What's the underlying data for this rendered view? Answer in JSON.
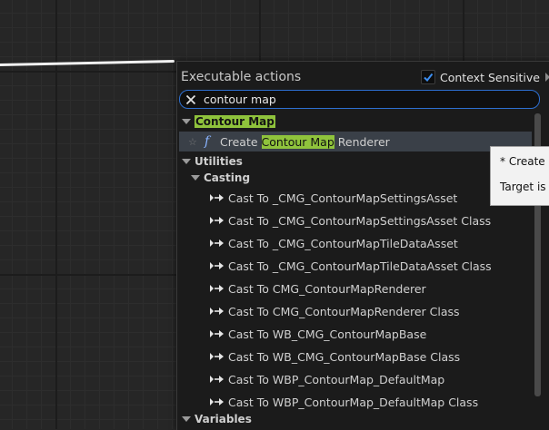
{
  "menu": {
    "title": "Executable actions",
    "context_sensitive": {
      "label": "Context Sensitive",
      "checked": true
    }
  },
  "search": {
    "value": "contour map"
  },
  "results": {
    "contour_category": {
      "label": "Contour Map"
    },
    "create_item": {
      "prefix": "Create ",
      "match": "Contour Map",
      "suffix": " Renderer"
    },
    "utilities": {
      "label": "Utilities"
    },
    "casting": {
      "label": "Casting"
    },
    "cast_items": [
      "Cast To _CMG_ContourMapSettingsAsset",
      "Cast To _CMG_ContourMapSettingsAsset Class",
      "Cast To _CMG_ContourMapTileDataAsset",
      "Cast To _CMG_ContourMapTileDataAsset Class",
      "Cast To CMG_ContourMapRenderer",
      "Cast To CMG_ContourMapRenderer Class",
      "Cast To WB_CMG_ContourMapBase",
      "Cast To WB_CMG_ContourMapBase Class",
      "Cast To WBP_ContourMap_DefaultMap",
      "Cast To WBP_ContourMap_DefaultMap Class"
    ],
    "variables": {
      "label": "Variables"
    }
  },
  "tooltip": {
    "line1": "* Create +",
    "line2": "Target is C"
  },
  "colors": {
    "highlight": "#8fc33c",
    "search_border": "#2d6fd0",
    "selection": "#3a4048"
  }
}
